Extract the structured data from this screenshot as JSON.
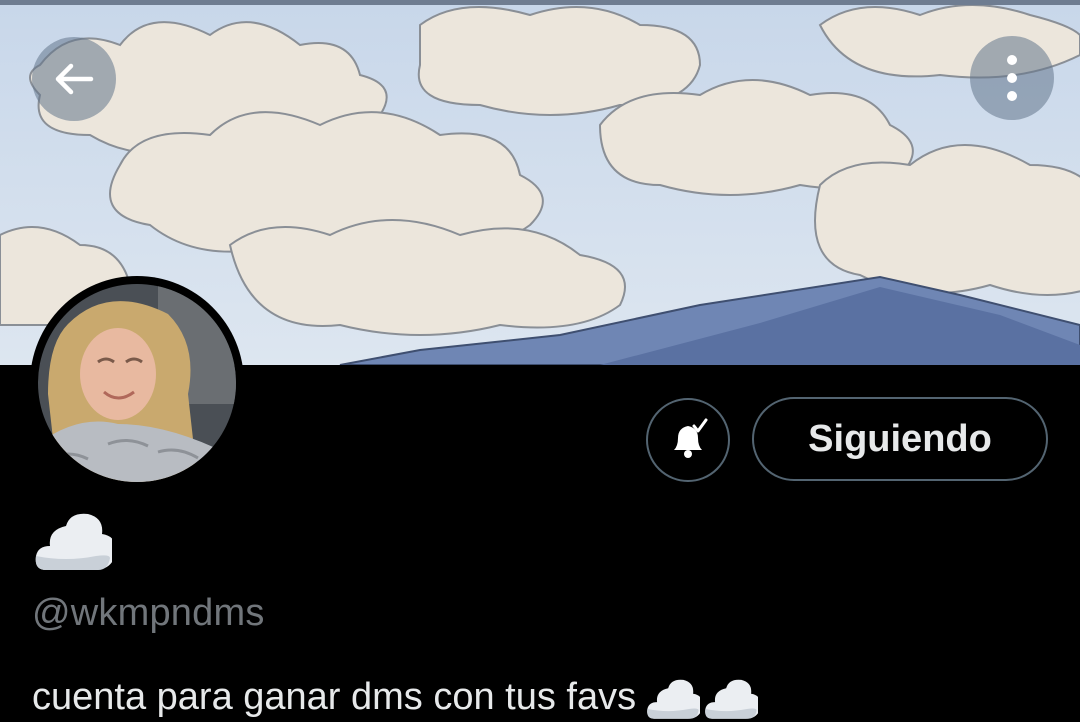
{
  "profile": {
    "display_name_icon": "cloud-emoji",
    "handle": "@wkmpndms",
    "bio_text": "cuenta para ganar dms con tus favs",
    "bio_emojis": [
      "cloud-emoji",
      "cloud-emoji"
    ]
  },
  "header": {
    "back_icon": "arrow-left-icon",
    "more_icon": "more-vertical-icon"
  },
  "actions": {
    "notification_icon": "bell-check-icon",
    "follow_label": "Siguiendo"
  },
  "colors": {
    "background": "#000000",
    "text_primary": "#e7e9ea",
    "text_secondary": "#71767b",
    "button_border": "#536471"
  }
}
